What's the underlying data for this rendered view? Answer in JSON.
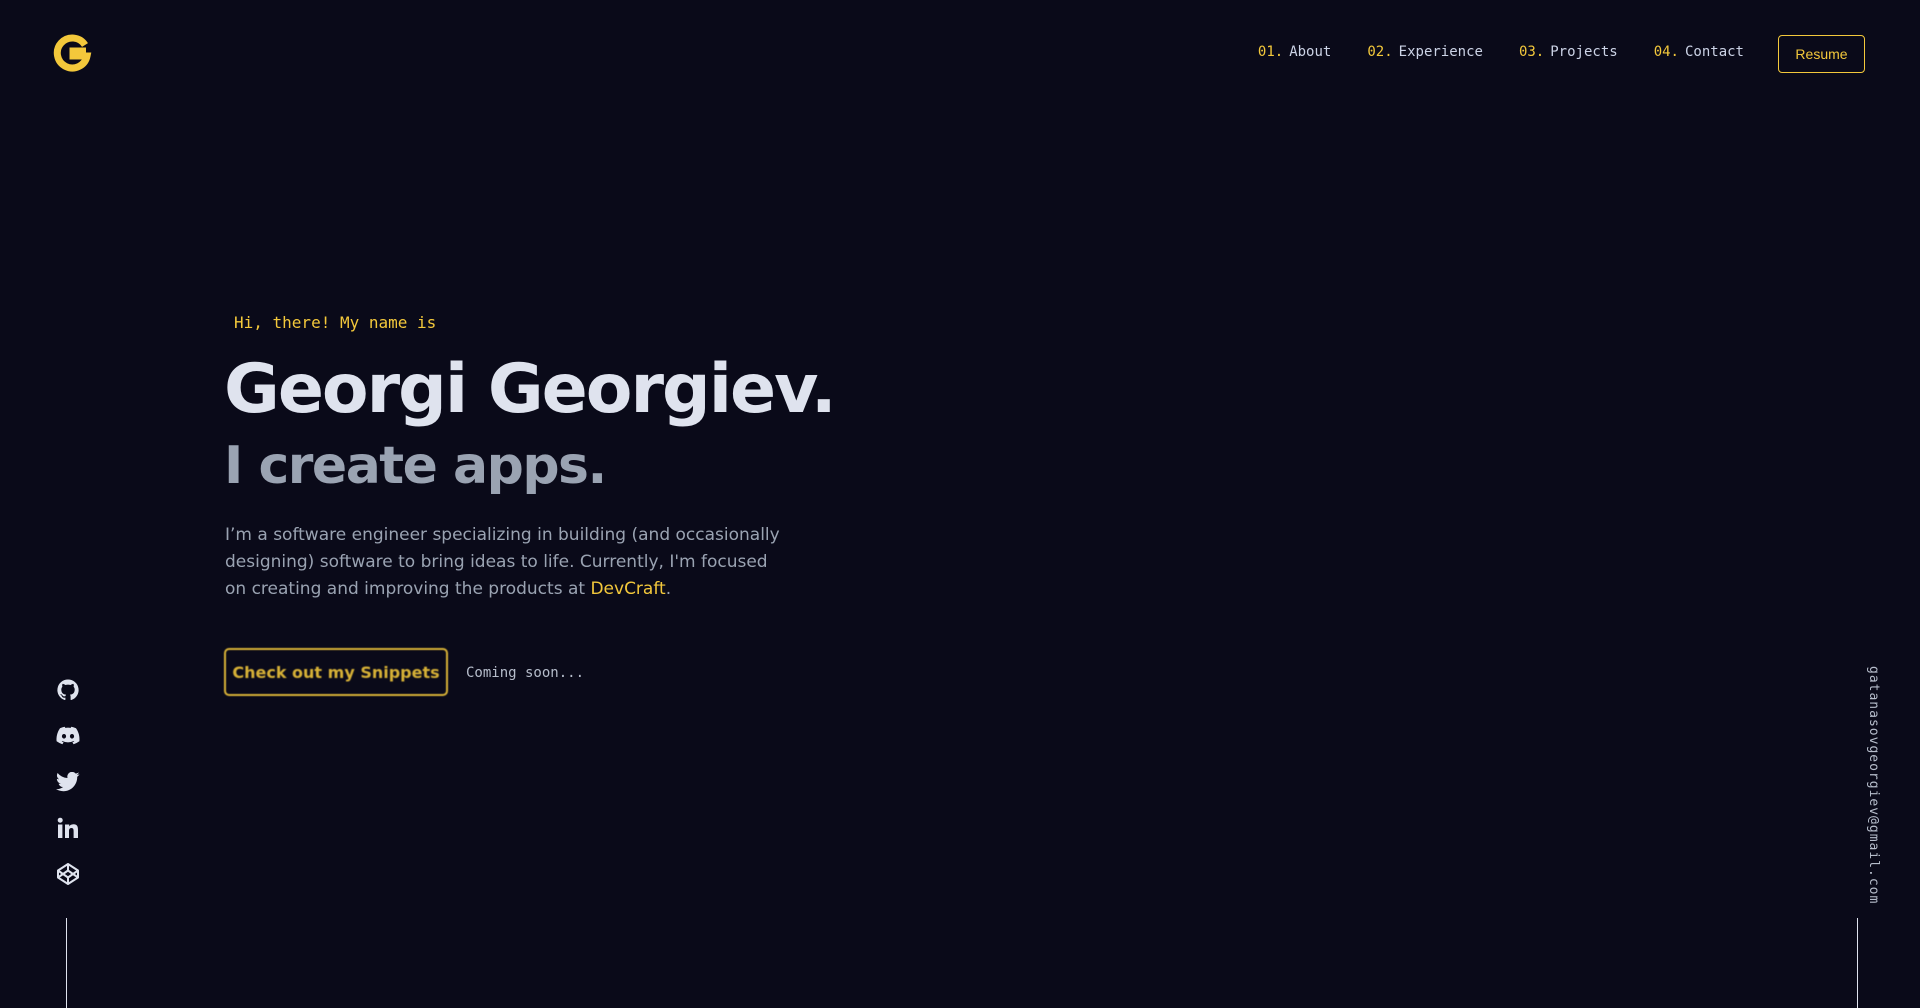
{
  "header": {
    "logo_letter": "G",
    "nav": [
      {
        "num": "01.",
        "label": "About"
      },
      {
        "num": "02.",
        "label": "Experience"
      },
      {
        "num": "03.",
        "label": "Projects"
      },
      {
        "num": "04.",
        "label": "Contact"
      }
    ],
    "resume_label": "Resume"
  },
  "hero": {
    "greeting": "Hi, there! My name is",
    "name": "Georgi Georgiev.",
    "tagline": "I create apps.",
    "intro_text": "I’m a software engineer specializing in building (and occasionally designing) software to bring ideas to life. Currently, I'm focused on creating and improving the products at ",
    "intro_link": "DevCraft",
    "intro_end": ".",
    "cta_label": "Check out my Snippets",
    "coming_soon": "Coming soon..."
  },
  "social": {
    "icons": [
      "github-icon",
      "discord-icon",
      "twitter-icon",
      "linkedin-icon",
      "codepen-icon"
    ]
  },
  "email": "gatanasovgeorgiev@gmail.com",
  "colors": {
    "background": "#0a0a19",
    "accent": "#f3c83b",
    "heading": "#dfe3ee",
    "muted": "#9aa3b2"
  }
}
